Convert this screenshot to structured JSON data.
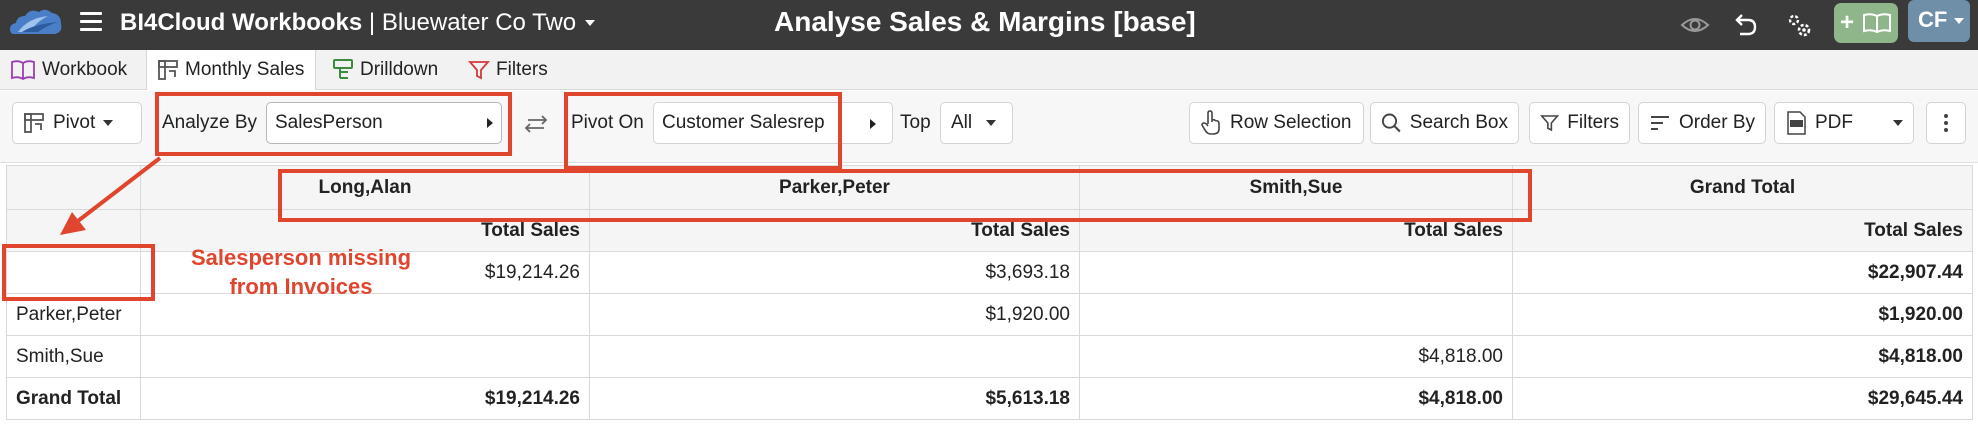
{
  "header": {
    "app_title": "BI4Cloud Workbooks",
    "separator": "|",
    "company": "Bluewater Co Two",
    "page_title": "Analyse Sales & Margins [base]",
    "user_initials": "CF",
    "add_label": "+"
  },
  "tabs": [
    {
      "label": "Workbook",
      "icon": "book-icon"
    },
    {
      "label": "Monthly Sales",
      "icon": "pivot-icon",
      "active": true
    },
    {
      "label": "Drilldown",
      "icon": "drilldown-icon"
    },
    {
      "label": "Filters",
      "icon": "filter-icon"
    }
  ],
  "toolbar": {
    "pivot_label": "Pivot",
    "analyze_by_label": "Analyze By",
    "analyze_by_value": "SalesPerson",
    "pivot_on_label": "Pivot On",
    "pivot_on_value": "Customer Salesrep",
    "top_label": "Top",
    "top_value": "All",
    "row_selection_label": "Row Selection",
    "search_box_label": "Search Box",
    "filters_label": "Filters",
    "order_by_label": "Order By",
    "export_label": "PDF"
  },
  "table": {
    "pivot_columns": [
      "Long,Alan",
      "Parker,Peter",
      "Smith,Sue",
      "Grand Total"
    ],
    "measure_label": "Total Sales",
    "rows": [
      {
        "label": "",
        "values": [
          "$19,214.26",
          "$3,693.18",
          "",
          "$22,907.44"
        ]
      },
      {
        "label": "Parker,Peter",
        "values": [
          "",
          "$1,920.00",
          "",
          "$1,920.00"
        ]
      },
      {
        "label": "Smith,Sue",
        "values": [
          "",
          "",
          "$4,818.00",
          "$4,818.00"
        ]
      },
      {
        "label": "Grand Total",
        "values": [
          "$19,214.26",
          "$5,613.18",
          "$4,818.00",
          "$29,645.44"
        ]
      }
    ]
  },
  "annotation": {
    "line1": "Salesperson missing",
    "line2": "from Invoices",
    "color": "#e0452e"
  },
  "colors": {
    "topbar": "#3a3a3a",
    "add_button": "#8fb58a",
    "user_button": "#6f8ea8"
  }
}
